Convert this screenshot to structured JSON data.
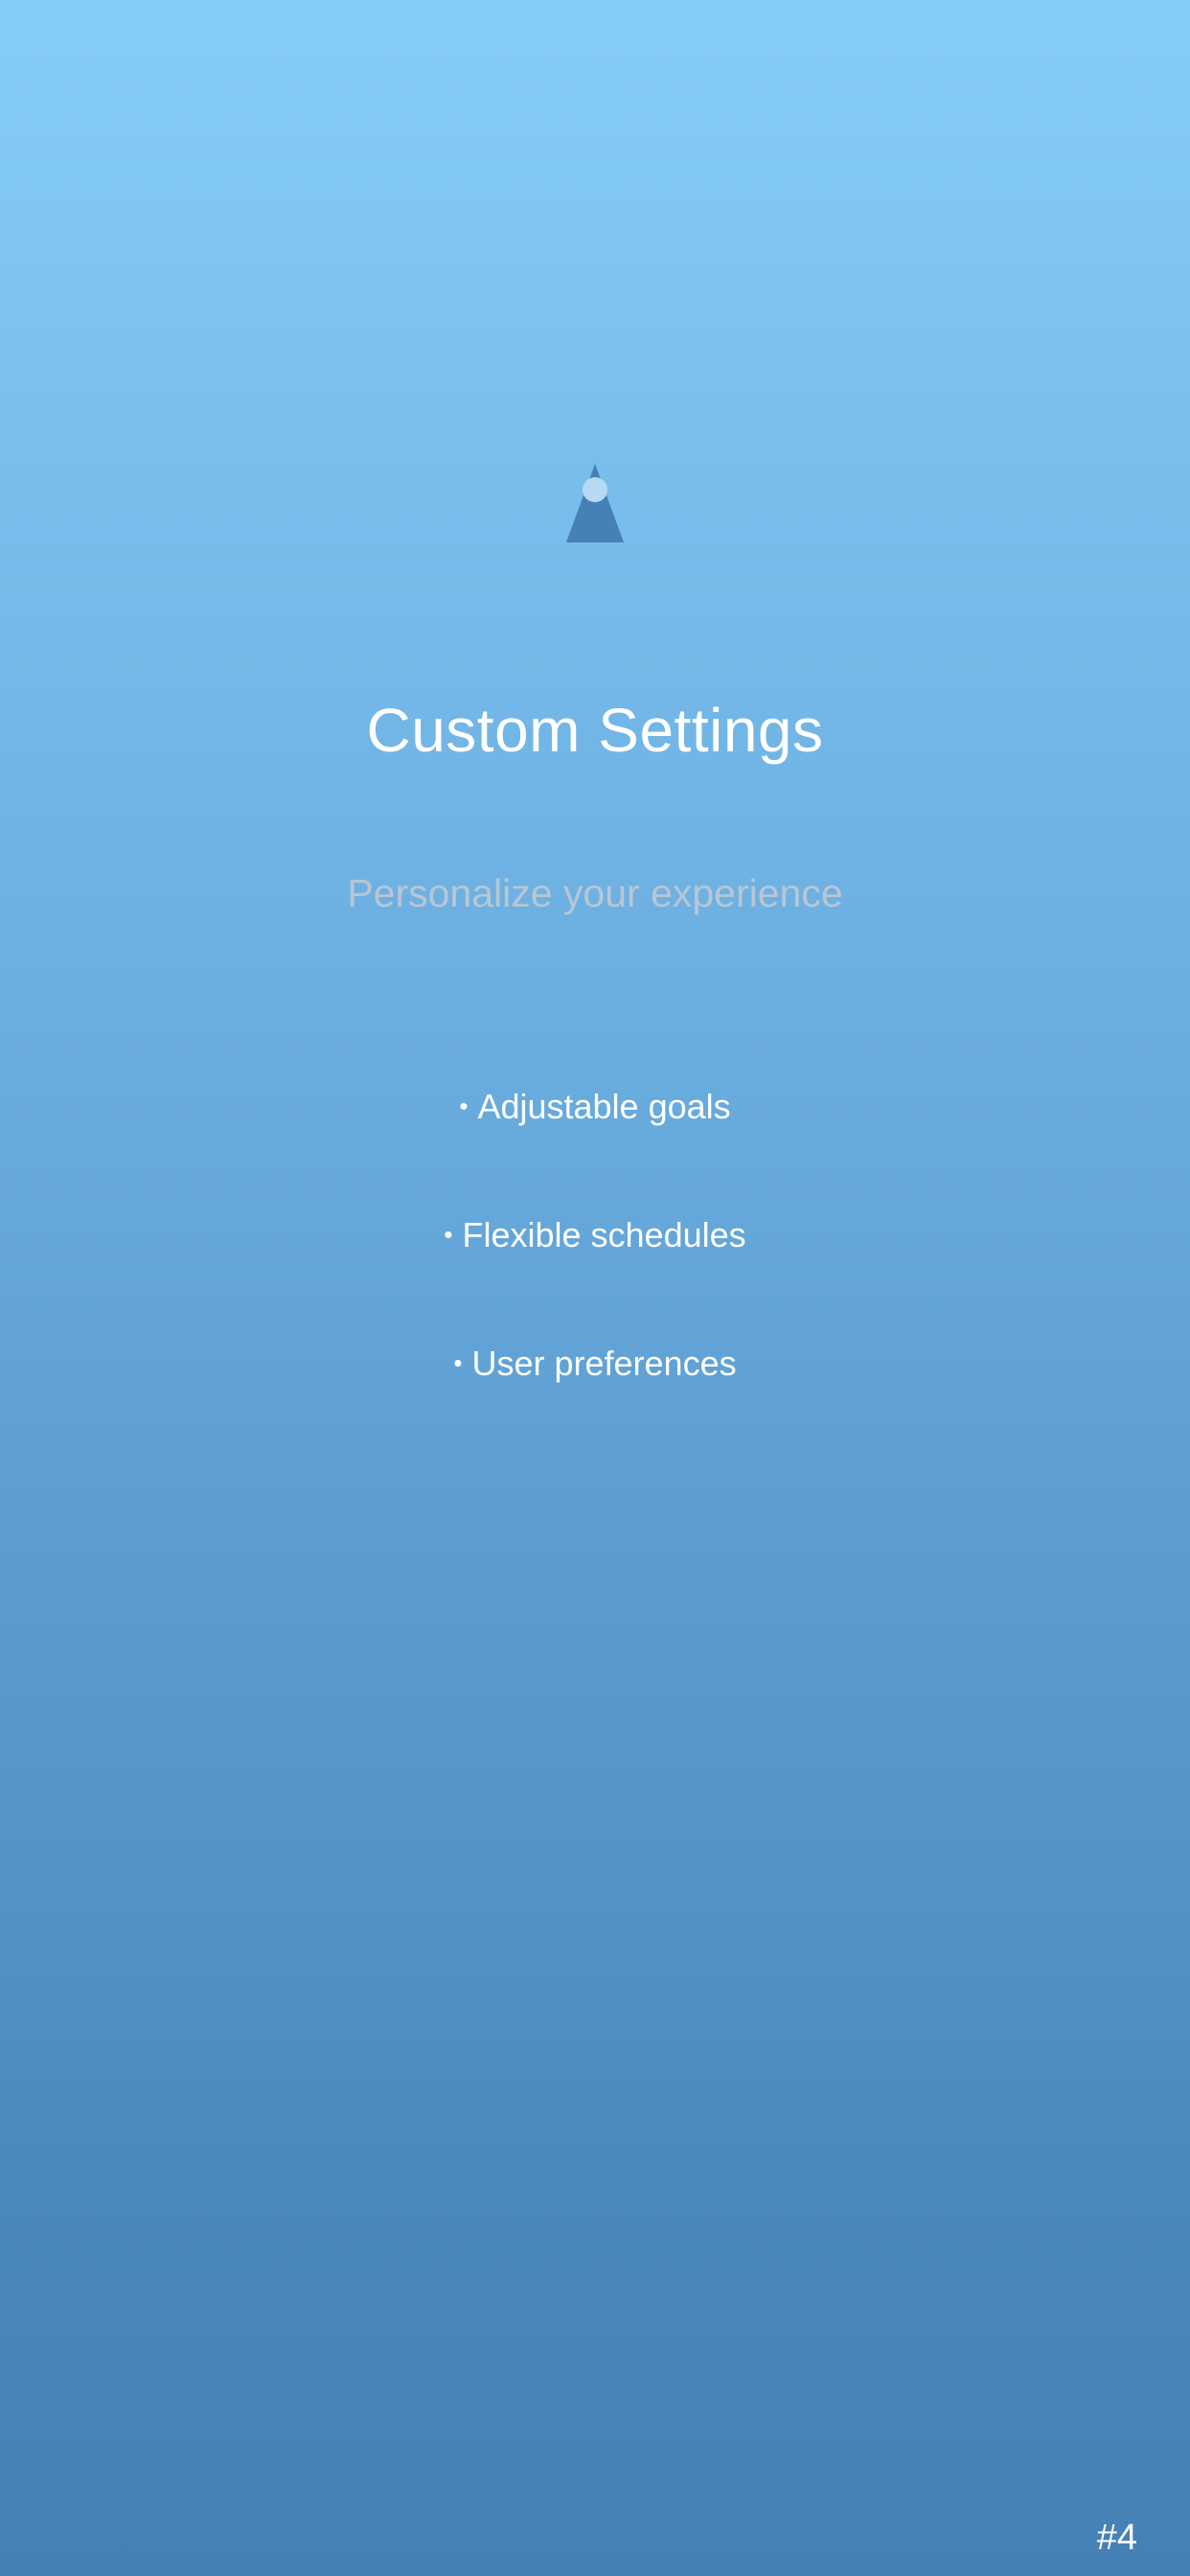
{
  "screen": {
    "title": "Custom Settings",
    "subtitle": "Personalize your experience",
    "logo_icon": "cone-person-icon",
    "features": [
      "Adjustable goals",
      "Flexible schedules",
      "User preferences"
    ],
    "bullet": "•",
    "page_indicator": "#4"
  },
  "colors": {
    "background_top": "#85cdf9",
    "background_bottom": "#4680b6",
    "title": "#ffffff",
    "subtitle": "#b9c6d4",
    "logo_body": "#4680b6",
    "logo_head": "#b8d9f2"
  }
}
